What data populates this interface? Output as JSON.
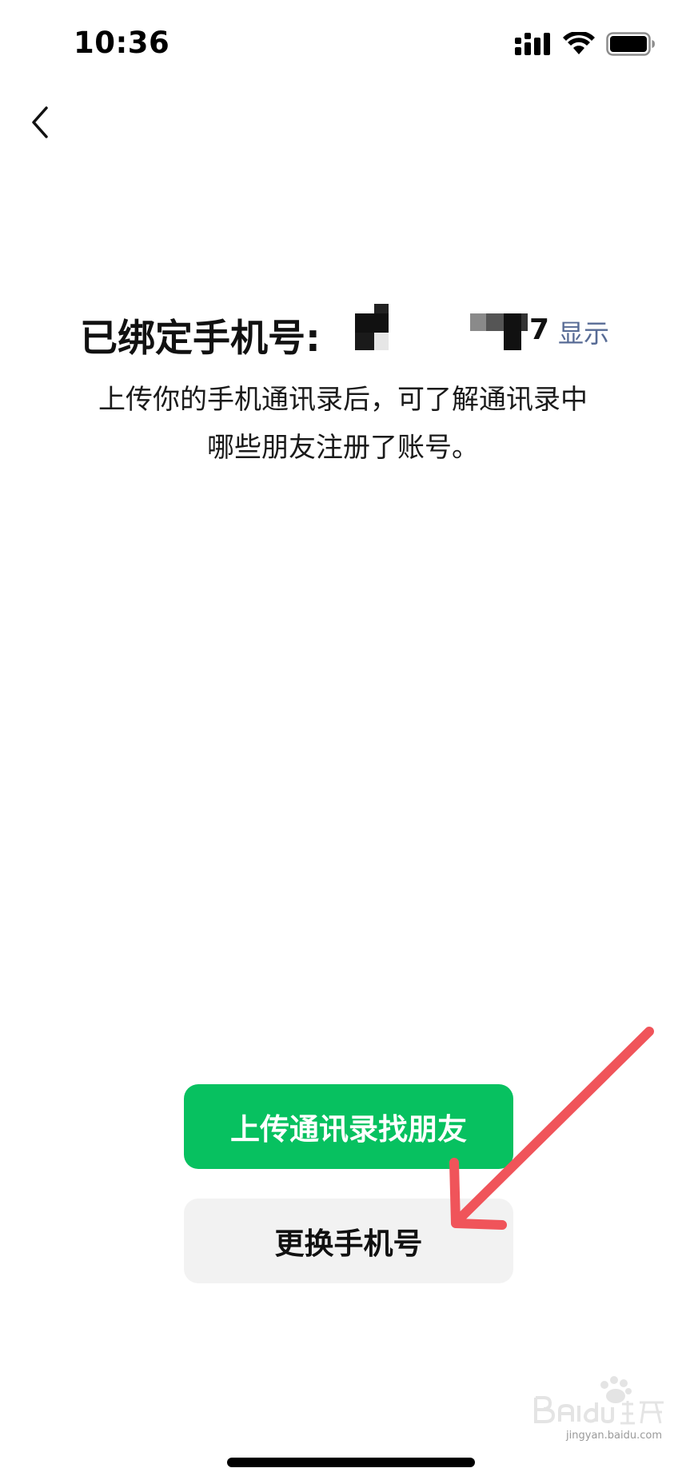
{
  "status_bar": {
    "time": "10:36",
    "icons": [
      "signal-icon",
      "wifi-icon",
      "battery-icon"
    ]
  },
  "nav": {
    "back_icon": "chevron-left-icon"
  },
  "header": {
    "bound_label": "已绑定手机号:",
    "phone_tail": "7",
    "show_link": "显示"
  },
  "description": {
    "line1": "上传你的手机通讯录后，可了解通讯录中",
    "line2": "哪些朋友注册了账号。"
  },
  "buttons": {
    "upload_contacts": "上传通讯录找朋友",
    "change_phone": "更换手机号"
  },
  "watermark": {
    "text": "jingyan.baidu.com"
  },
  "colors": {
    "primary_green": "#07c160",
    "secondary_gray": "#f2f2f2",
    "link_blue": "#576b95",
    "annotation_red": "#f0545a"
  }
}
